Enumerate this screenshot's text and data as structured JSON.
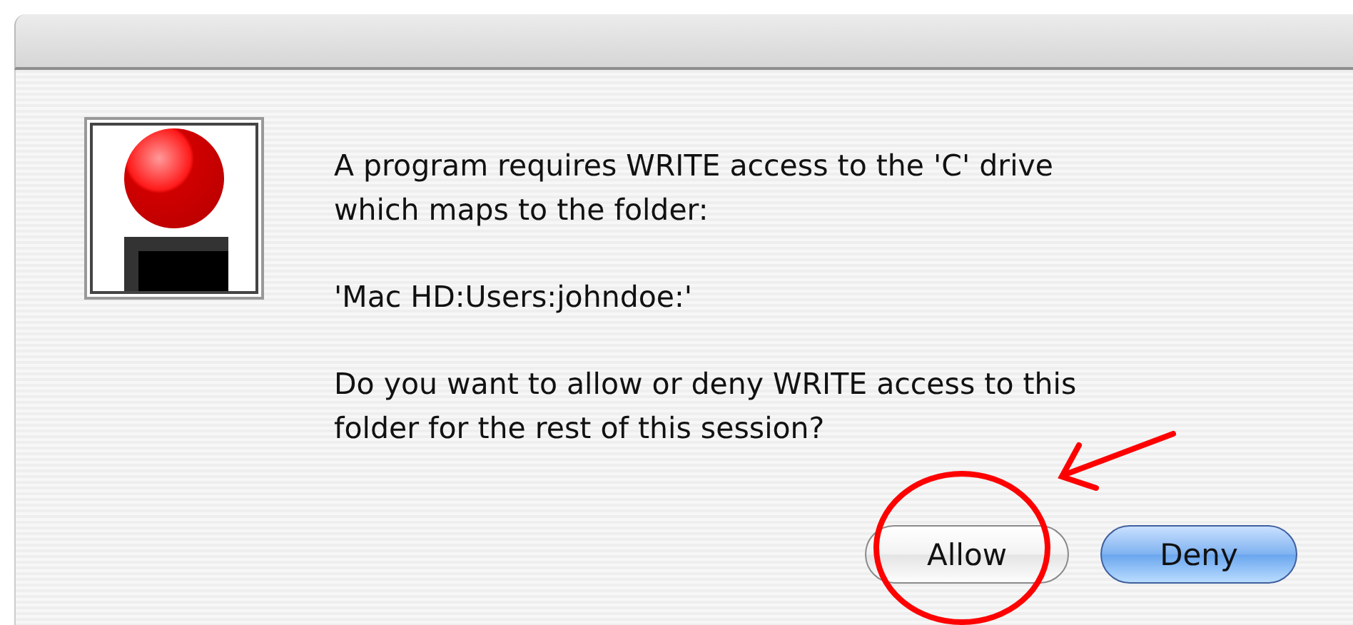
{
  "dialog": {
    "paragraphs": [
      "A program requires WRITE access to the 'C' drive\nwhich maps to the folder:",
      "'Mac HD:Users:johndoe:'",
      "Do you want to allow or deny WRITE access to this\nfolder for the rest of this session?"
    ],
    "buttons": [
      {
        "label": "Allow",
        "default": false
      },
      {
        "label": "Deny",
        "default": true
      }
    ]
  }
}
